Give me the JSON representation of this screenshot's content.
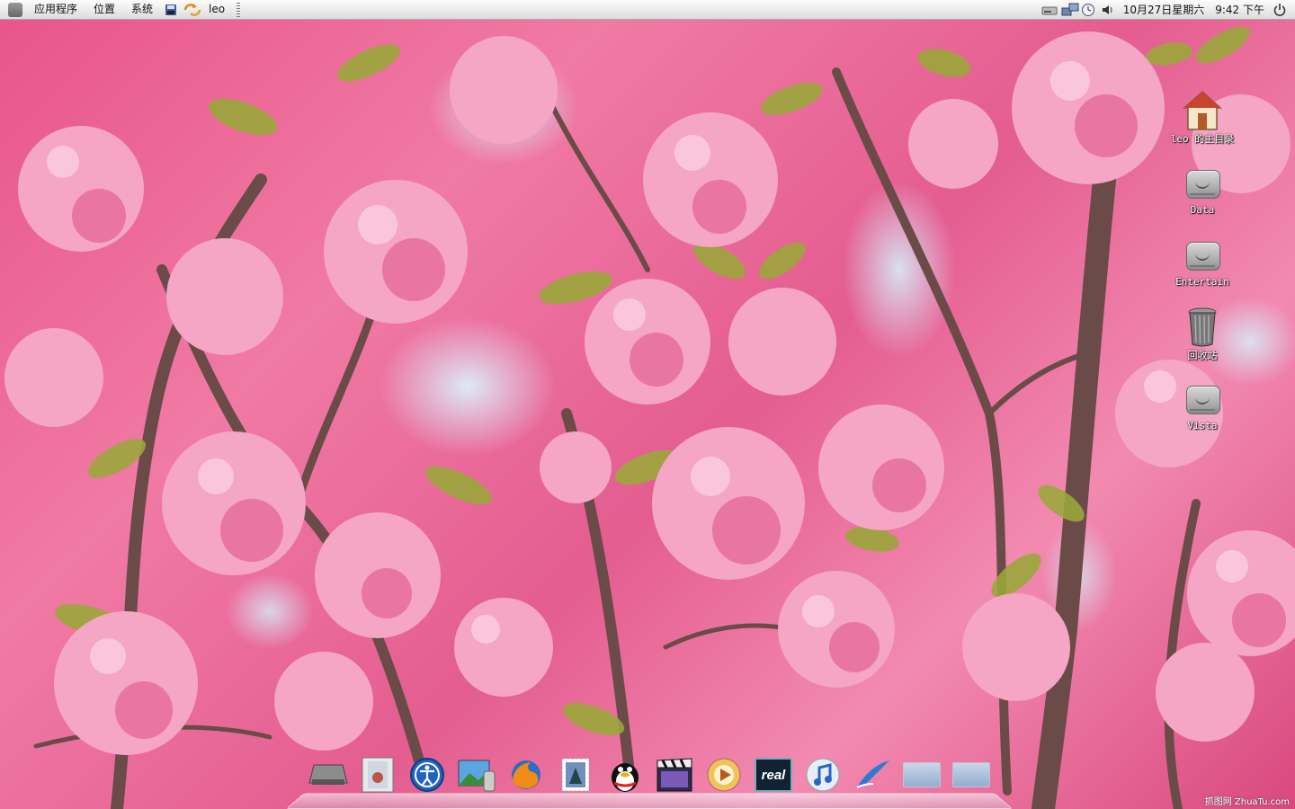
{
  "top_panel": {
    "menus": [
      "应用程序",
      "位置",
      "系统"
    ],
    "user": "leo",
    "datetime": "10月27日星期六",
    "time": "9:42 下午"
  },
  "desktop_icons": [
    {
      "label": "leo 的主目录",
      "icon": "home-folder-icon"
    },
    {
      "label": "Data",
      "icon": "hard-drive-icon"
    },
    {
      "label": "Entertain",
      "icon": "hard-drive-icon"
    },
    {
      "label": "回收站",
      "icon": "trash-icon"
    },
    {
      "label": "Vista",
      "icon": "hard-drive-icon"
    }
  ],
  "dock": {
    "items": [
      "drive-icon",
      "documents-icon",
      "accessibility-icon",
      "image-viewer-icon",
      "firefox-icon",
      "mail-stamp-icon",
      "qq-penguin-icon",
      "movie-clapper-icon",
      "media-player-icon",
      "real-label",
      "itunes-note-icon",
      "pencil-app-icon",
      "stack-folder-icon",
      "stack-folder-icon"
    ],
    "real_label": "real"
  },
  "watermark": "抓图网 ZhuaTu.com",
  "colors": {
    "panel": "#e9e9e9",
    "blossom": "#f07aa4",
    "sky": "#dcf0fc"
  }
}
